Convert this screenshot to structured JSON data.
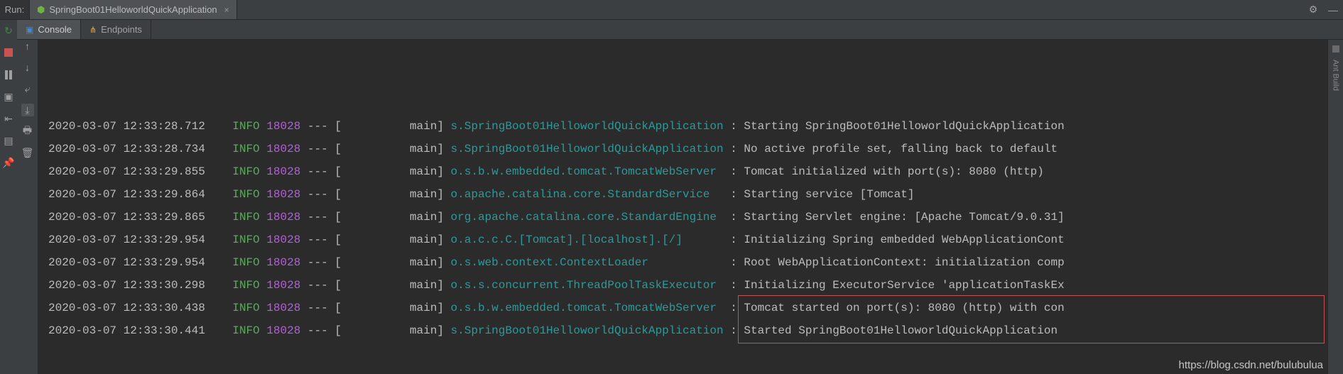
{
  "run_panel_label": "Run:",
  "run_tab_title": "SpringBoot01HelloworldQuickApplication",
  "subtabs": {
    "console": "Console",
    "endpoints": "Endpoints"
  },
  "side_label": "Ant Build",
  "watermark": "https://blog.csdn.net/bulubulua",
  "log_col_widths": {
    "ts": 25,
    "lvl": 5,
    "pid": 5,
    "thr": 20,
    "cls": 40
  },
  "logs": [
    {
      "ts": "2020-03-07 12:33:28.712",
      "lvl": "INFO",
      "pid": "18028",
      "thr": "main",
      "cls": "s.SpringBoot01HelloworldQuickApplication",
      "msg": "Starting SpringBoot01HelloworldQuickApplication"
    },
    {
      "ts": "2020-03-07 12:33:28.734",
      "lvl": "INFO",
      "pid": "18028",
      "thr": "main",
      "cls": "s.SpringBoot01HelloworldQuickApplication",
      "msg": "No active profile set, falling back to default"
    },
    {
      "ts": "2020-03-07 12:33:29.855",
      "lvl": "INFO",
      "pid": "18028",
      "thr": "main",
      "cls": "o.s.b.w.embedded.tomcat.TomcatWebServer",
      "msg": "Tomcat initialized with port(s): 8080 (http)"
    },
    {
      "ts": "2020-03-07 12:33:29.864",
      "lvl": "INFO",
      "pid": "18028",
      "thr": "main",
      "cls": "o.apache.catalina.core.StandardService",
      "msg": "Starting service [Tomcat]"
    },
    {
      "ts": "2020-03-07 12:33:29.865",
      "lvl": "INFO",
      "pid": "18028",
      "thr": "main",
      "cls": "org.apache.catalina.core.StandardEngine",
      "msg": "Starting Servlet engine: [Apache Tomcat/9.0.31]"
    },
    {
      "ts": "2020-03-07 12:33:29.954",
      "lvl": "INFO",
      "pid": "18028",
      "thr": "main",
      "cls": "o.a.c.c.C.[Tomcat].[localhost].[/]",
      "msg": "Initializing Spring embedded WebApplicationCont"
    },
    {
      "ts": "2020-03-07 12:33:29.954",
      "lvl": "INFO",
      "pid": "18028",
      "thr": "main",
      "cls": "o.s.web.context.ContextLoader",
      "msg": "Root WebApplicationContext: initialization comp"
    },
    {
      "ts": "2020-03-07 12:33:30.298",
      "lvl": "INFO",
      "pid": "18028",
      "thr": "main",
      "cls": "o.s.s.concurrent.ThreadPoolTaskExecutor",
      "msg": "Initializing ExecutorService 'applicationTaskEx"
    },
    {
      "ts": "2020-03-07 12:33:30.438",
      "lvl": "INFO",
      "pid": "18028",
      "thr": "main",
      "cls": "o.s.b.w.embedded.tomcat.TomcatWebServer",
      "msg": "Tomcat started on port(s): 8080 (http) with con"
    },
    {
      "ts": "2020-03-07 12:33:30.441",
      "lvl": "INFO",
      "pid": "18028",
      "thr": "main",
      "cls": "s.SpringBoot01HelloworldQuickApplication",
      "msg": "Started SpringBoot01HelloworldQuickApplication"
    }
  ],
  "highlight": {
    "from_row": 8,
    "to_row": 9
  }
}
